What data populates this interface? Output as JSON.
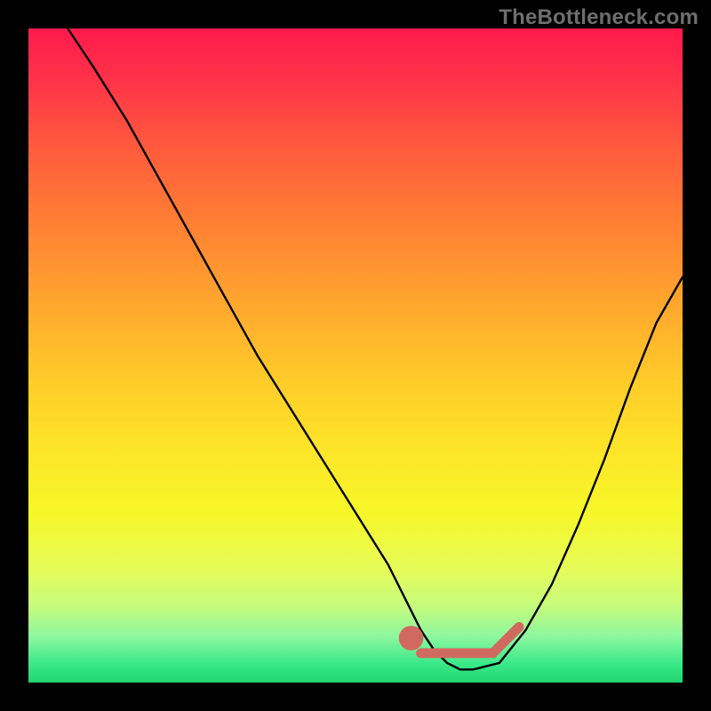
{
  "watermark": "TheBottleneck.com",
  "chart_data": {
    "type": "line",
    "title": "",
    "xlabel": "",
    "ylabel": "",
    "xlim": [
      0,
      100
    ],
    "ylim": [
      0,
      100
    ],
    "series": [
      {
        "name": "bottleneck-curve",
        "x": [
          6,
          10,
          15,
          20,
          25,
          30,
          35,
          40,
          45,
          50,
          55,
          58,
          60,
          62,
          64,
          66,
          68,
          72,
          76,
          80,
          84,
          88,
          92,
          96,
          100
        ],
        "y": [
          100,
          94,
          86,
          77,
          68,
          59,
          50,
          42,
          34,
          26,
          18,
          12,
          8,
          5,
          3,
          2,
          2,
          3,
          8,
          15,
          24,
          34,
          45,
          55,
          62
        ]
      }
    ],
    "markers": [
      {
        "name": "highlight-dot",
        "x": 58.5,
        "y": 6.8,
        "color": "#d06a5f",
        "r": 1.2
      },
      {
        "name": "highlight-segment-start",
        "x": 60,
        "y": 4.5,
        "color": "#d06a5f"
      },
      {
        "name": "highlight-segment-end",
        "x": 71,
        "y": 4.5,
        "color": "#d06a5f"
      },
      {
        "name": "highlight-tail-end",
        "x": 75,
        "y": 8.5,
        "color": "#d06a5f"
      }
    ],
    "colors": {
      "curve": "#000000",
      "highlight": "#d06a5f",
      "gradient_top": "#ff1a4d",
      "gradient_bottom": "#1fd66e"
    }
  }
}
